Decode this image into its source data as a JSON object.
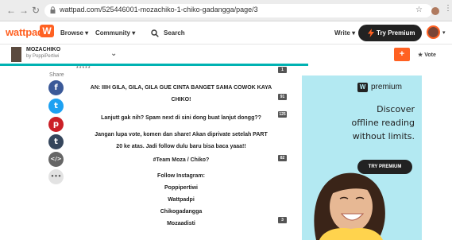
{
  "browser": {
    "back_icon": "arrow-left-icon",
    "forward_icon": "arrow-right-icon",
    "reload_icon": "reload-icon",
    "url": "wattpad.com/525446001-mozachiko-1-chiko-gadangga/page/3"
  },
  "header": {
    "logo_text": "wattpad",
    "logo_glyph": "W",
    "browse_label": "Browse ▾",
    "community_label": "Community ▾",
    "search_label": "Search",
    "write_label": "Write ▾",
    "premium_label": "Try Premium",
    "caret": "▾"
  },
  "story": {
    "title": "MOZACHIKO",
    "author": "by PoppiPertiwi",
    "plus_label": "+",
    "vote_label": "★  Vote",
    "separator": "*****"
  },
  "share": {
    "label": "Share",
    "buttons": [
      {
        "glyph": "f",
        "color": "#3b5998"
      },
      {
        "glyph": "t",
        "color": "#1da1f2"
      },
      {
        "glyph": "p",
        "color": "#cb2027"
      },
      {
        "glyph": "t",
        "color": "#35465c"
      },
      {
        "glyph": "</>",
        "color": "#666666"
      },
      {
        "glyph": "•••",
        "color": "#e3e3e3"
      }
    ]
  },
  "paragraphs": [
    {
      "lines": [
        "AN: IIIH GILA, GILA, GILA GUE CINTA BANGET SAMA COWOK KAYA",
        "CHIKO!"
      ],
      "comments": "91"
    },
    {
      "lines": [
        "Lanjutt gak nih? Spam next di sini dong buat lanjut dongg??"
      ],
      "comments": "125"
    },
    {
      "lines": [
        "Jangan lupa vote, komen dan share! Akan diprivate setelah PART",
        "20 ke atas. Jadi follow dulu baru bisa baca yaaa!!"
      ],
      "comments": ""
    },
    {
      "lines": [
        "#Team Moza / Chiko?"
      ],
      "comments": "82"
    },
    {
      "lines": [
        "Follow Instagram:",
        "Poppipertiwi",
        "Wattpadpi",
        "Chikogadangga",
        "Mozaadisti"
      ],
      "comments": "3"
    }
  ],
  "top_comment_count": "1",
  "ad": {
    "brand_glyph": "W",
    "brand_text": "premium",
    "lines": [
      "Discover",
      "offline reading",
      "without limits."
    ],
    "cta": "TRY PREMIUM"
  },
  "colors": {
    "brand": "#ff6122",
    "accent": "#00b2b2",
    "ad_bg": "#b3e9f2"
  }
}
